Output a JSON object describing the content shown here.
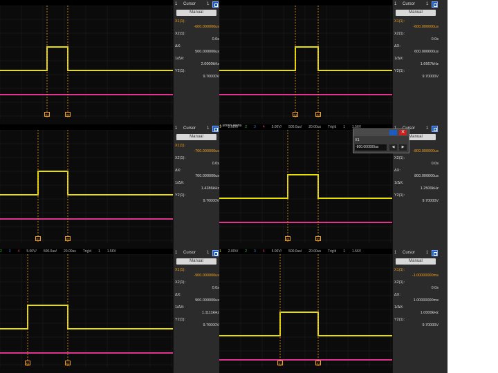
{
  "panels": [
    {
      "menu": "",
      "topbar": [],
      "x1": "-600.000000us",
      "x2": "0.0s",
      "dx": "500.000000us",
      "inv_dx": "2.0000kHz",
      "y2": "9.70000V"
    },
    {
      "menu": "",
      "topbar": [],
      "x1": "-600.000000us",
      "x2": "0.0s",
      "dx": "600.000000us",
      "inv_dx": "1.6667kHz",
      "y2": "9.70000V"
    },
    {
      "menu": "",
      "topbar": [],
      "x1": "-700.000000us",
      "x2": "0.0s",
      "dx": "700.000000us",
      "inv_dx": "1.4286kHz",
      "y2": "9.70000V"
    },
    {
      "menu": "Cursors Menu",
      "topbar": [
        "1",
        "2.00V/",
        "2",
        "3",
        "4",
        "5.00V/",
        "500.0us/",
        "20.00us",
        "Trig'd",
        "1",
        "1.56V"
      ],
      "x1": "-800.000000us",
      "x2": "0.0s",
      "dx": "800.000000us",
      "inv_dx": "1.2500kHz",
      "y2": "9.70000V"
    },
    {
      "menu": "",
      "topbar": [
        "2",
        "3",
        "4",
        "5.00V/",
        "500.0us/",
        "20.00us",
        "Trig'd",
        "1",
        "1.56V"
      ],
      "x1": "-900.000000us",
      "x2": "0.0s",
      "dx": "900.000000us",
      "inv_dx": "1.1111kHz",
      "y2": "9.70000V"
    },
    {
      "menu": "",
      "topbar": [
        "1",
        "2.00V/",
        "2",
        "3",
        "4",
        "5.00V/",
        "500.0us/",
        "20.00us",
        "Trig'd",
        "1",
        "1.56V"
      ],
      "x1": "-1.00000000ms",
      "x2": "0.0s",
      "dx": "1.00000000ms",
      "inv_dx": "1.0000kHz",
      "y2": "9.70000V"
    }
  ],
  "labels": {
    "cursor": "Cursor",
    "cursor_num": "1",
    "mode": "Manual",
    "x1": "X1(1):",
    "x2": "X2(1):",
    "dx": "ΔX:",
    "inv_dx": "1/ΔX:",
    "y2": "Y2(1):",
    "popup_x1": "X1"
  },
  "popup": {
    "value": "-800.000000us"
  },
  "colors": {
    "ch1": "#e7e000",
    "ch4": "#e0358d",
    "cursor": "#f0a020"
  }
}
